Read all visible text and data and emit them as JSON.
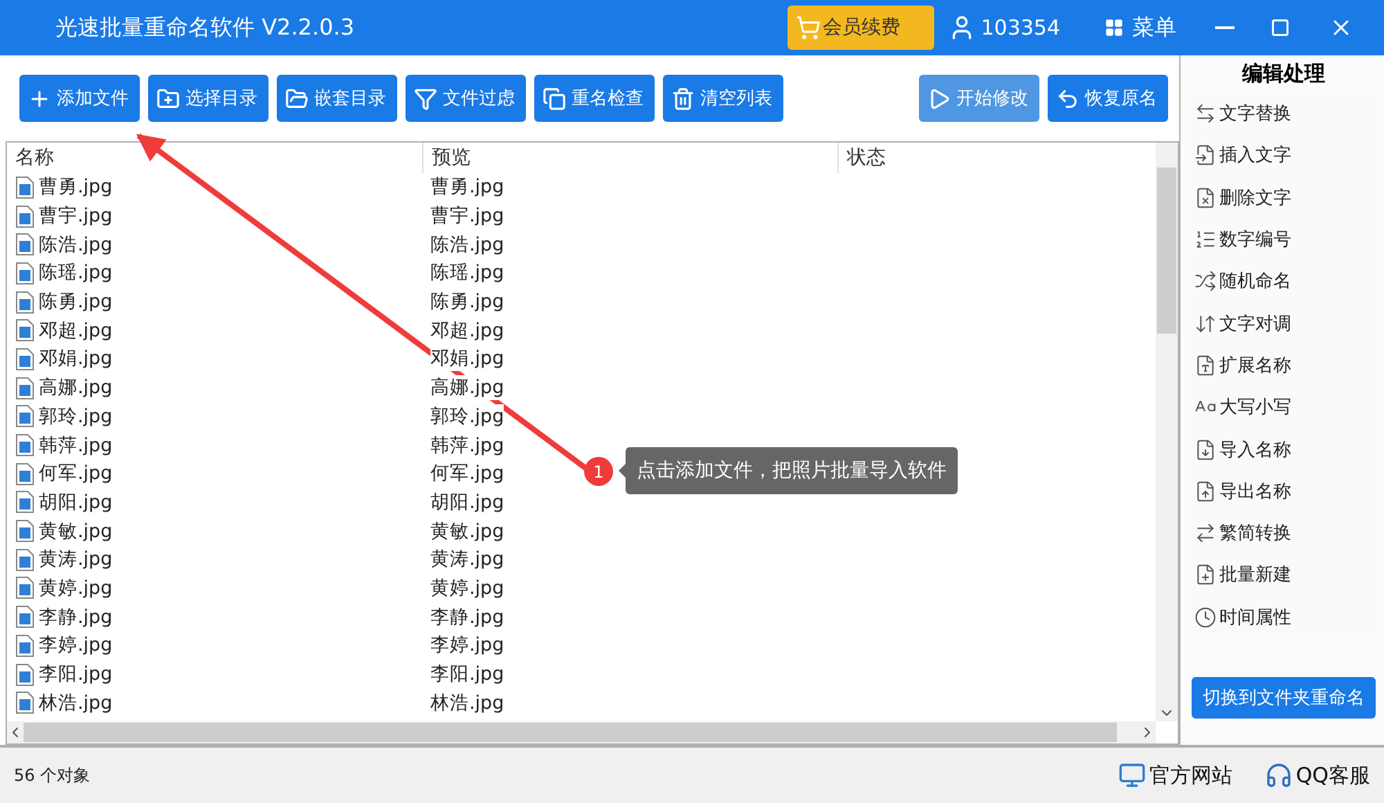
{
  "window": {
    "title": "光速批量重命名软件 V2.2.0.3"
  },
  "header": {
    "vip_button": "会员续费",
    "user_id": "103354",
    "menu": "菜单"
  },
  "toolbar": {
    "left": [
      {
        "label": "添加文件",
        "disabled": false
      },
      {
        "label": "选择目录",
        "disabled": false
      },
      {
        "label": "嵌套目录",
        "disabled": false
      },
      {
        "label": "文件过虑",
        "disabled": false
      },
      {
        "label": "重名检查",
        "disabled": false
      },
      {
        "label": "清空列表",
        "disabled": false
      }
    ],
    "right": [
      {
        "label": "开始修改",
        "disabled": true
      },
      {
        "label": "恢复原名",
        "disabled": false
      }
    ]
  },
  "file_list": {
    "columns": [
      "名称",
      "预览",
      "状态"
    ],
    "rows": [
      {
        "name": "曹勇.jpg",
        "preview": "曹勇.jpg"
      },
      {
        "name": "曹宇.jpg",
        "preview": "曹宇.jpg"
      },
      {
        "name": "陈浩.jpg",
        "preview": "陈浩.jpg"
      },
      {
        "name": "陈瑶.jpg",
        "preview": "陈瑶.jpg"
      },
      {
        "name": "陈勇.jpg",
        "preview": "陈勇.jpg"
      },
      {
        "name": "邓超.jpg",
        "preview": "邓超.jpg"
      },
      {
        "name": "邓娟.jpg",
        "preview": "邓娟.jpg"
      },
      {
        "name": "高娜.jpg",
        "preview": "高娜.jpg"
      },
      {
        "name": "郭玲.jpg",
        "preview": "郭玲.jpg"
      },
      {
        "name": "韩萍.jpg",
        "preview": "韩萍.jpg"
      },
      {
        "name": "何军.jpg",
        "preview": "何军.jpg"
      },
      {
        "name": "胡阳.jpg",
        "preview": "胡阳.jpg"
      },
      {
        "name": "黄敏.jpg",
        "preview": "黄敏.jpg"
      },
      {
        "name": "黄涛.jpg",
        "preview": "黄涛.jpg"
      },
      {
        "name": "黄婷.jpg",
        "preview": "黄婷.jpg"
      },
      {
        "name": "李静.jpg",
        "preview": "李静.jpg"
      },
      {
        "name": "李婷.jpg",
        "preview": "李婷.jpg"
      },
      {
        "name": "李阳.jpg",
        "preview": "李阳.jpg"
      },
      {
        "name": "林浩.jpg",
        "preview": "林浩.jpg"
      }
    ]
  },
  "side_panel": {
    "title": "编辑处理",
    "items": [
      "文字替换",
      "插入文字",
      "删除文字",
      "数字编号",
      "随机命名",
      "文字对调",
      "扩展名称",
      "大写小写",
      "导入名称",
      "导出名称",
      "繁简转换",
      "批量新建",
      "时间属性"
    ],
    "switch_button": "切换到文件夹重命名"
  },
  "annotation": {
    "number": "1",
    "text": "点击添加文件，把照片批量导入软件"
  },
  "status_bar": {
    "count": "56 个对象",
    "links": [
      "官方网站",
      "QQ客服"
    ]
  }
}
